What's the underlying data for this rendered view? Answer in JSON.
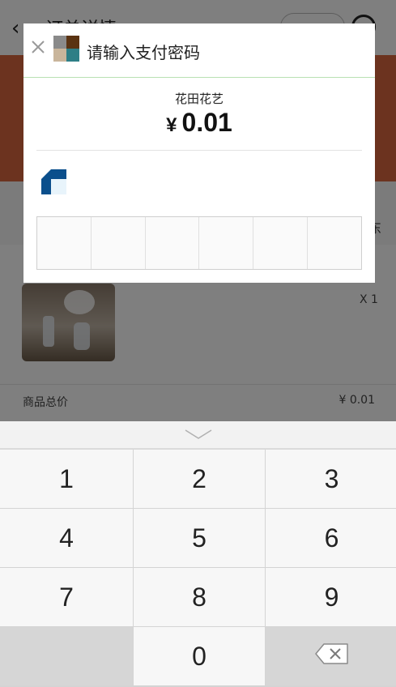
{
  "background": {
    "header_title": "订单详情",
    "band_text": "东",
    "item_qty": "X 1",
    "total_label": "商品总价",
    "total_value": "¥ 0.01",
    "banner_color": "#d9673f"
  },
  "dialog": {
    "close_icon": "close-icon",
    "title": "请输入支付密码",
    "merchant": "花田花艺",
    "currency": "¥",
    "amount": "0.01",
    "password_cells": 6,
    "accent_color": "#b9e0b2",
    "bank_logo_color": "#0b4f8c"
  },
  "keyboard": {
    "collapse_icon": "chevron-down-icon",
    "keys": [
      "1",
      "2",
      "3",
      "4",
      "5",
      "6",
      "7",
      "8",
      "9",
      "",
      "0",
      "backspace"
    ],
    "k1": "1",
    "k2": "2",
    "k3": "3",
    "k4": "4",
    "k5": "5",
    "k6": "6",
    "k7": "7",
    "k8": "8",
    "k9": "9",
    "k0": "0",
    "delete_icon": "backspace-icon"
  }
}
